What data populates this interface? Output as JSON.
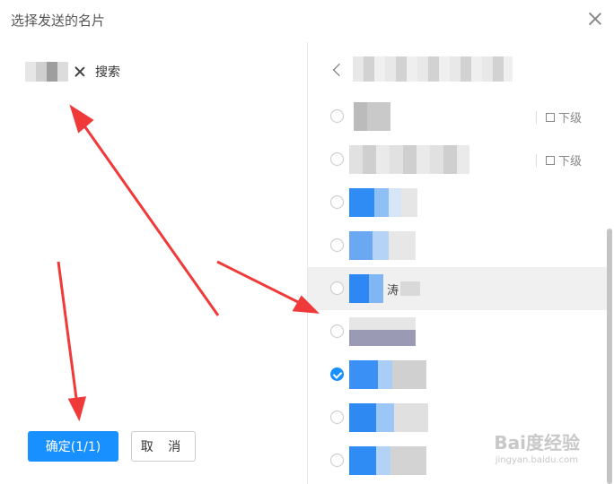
{
  "dialog": {
    "title": "选择发送的名片"
  },
  "left": {
    "search_label": "搜索"
  },
  "buttons": {
    "confirm": "确定(1/1)",
    "cancel": "取 消"
  },
  "right": {
    "rows": [
      {
        "text": "",
        "sub": "下级",
        "checked": false
      },
      {
        "text": "",
        "sub": "下级",
        "checked": false
      },
      {
        "text": "",
        "sub": "",
        "checked": false
      },
      {
        "text": "",
        "sub": "",
        "checked": false
      },
      {
        "text": "涛",
        "sub": "",
        "checked": false
      },
      {
        "text": "",
        "sub": "",
        "checked": false
      },
      {
        "text": "",
        "sub": "",
        "checked": true
      },
      {
        "text": "",
        "sub": "",
        "checked": false
      },
      {
        "text": "",
        "sub": "",
        "checked": false
      }
    ]
  },
  "watermark": {
    "main": "Bai度经验",
    "sub": "jingyan.baidu.com"
  },
  "colors": {
    "primary": "#1890ff",
    "arrow": "#f03a3a"
  }
}
